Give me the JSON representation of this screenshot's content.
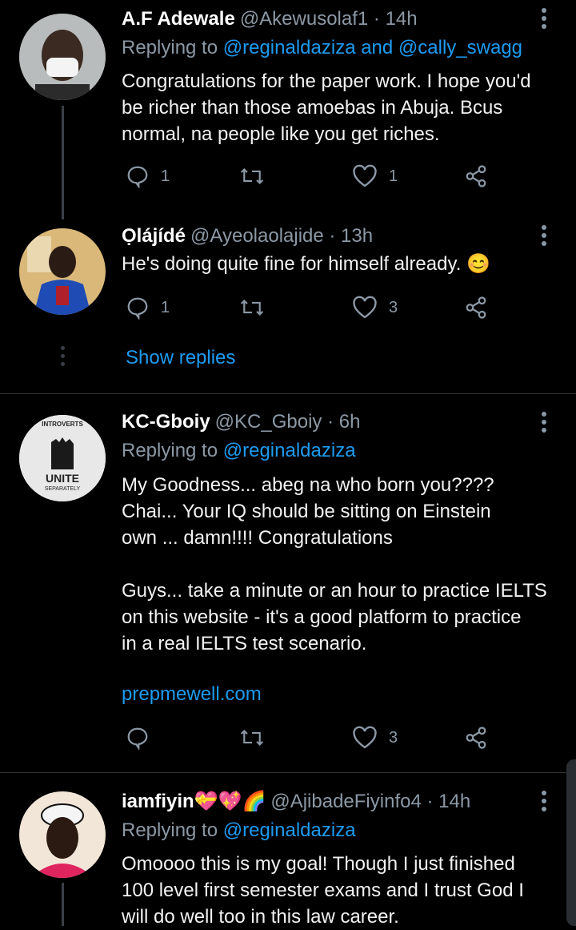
{
  "tweets": [
    {
      "name": "A.F Adewale",
      "handle": "@Akewusolaf1 · 14h",
      "replying_prefix": "Replying to",
      "replying_to": "@reginaldaziza and @cally_swagg",
      "body": "Congratulations for the paper work. I hope you'd\nbe richer than those amoebas in Abuja. Bcus\nnormal, na people like you get riches.",
      "reply_count": "1",
      "like_count": "1"
    },
    {
      "name": "Ọlájídé",
      "handle": "@Ayeolaolajide · 13h",
      "body": "He's doing quite fine for himself already. 😊",
      "reply_count": "1",
      "like_count": "3",
      "show_replies": "Show replies"
    },
    {
      "name": "KC-Gboiy",
      "handle": "@KC_Gboiy · 6h",
      "replying_prefix": "Replying to",
      "replying_to": "@reginaldaziza",
      "body": "My Goodness... abeg na who born you????\nChai... Your IQ should be sitting on Einstein\nown ... damn!!!! Congratulations\n\nGuys... take a minute or an hour to practice IELTS\non this website - it's a good platform to practice\nin a real IELTS test scenario.",
      "link": "prepmewell.com",
      "like_count": "3",
      "avatar_text_top": "INTROVERTS",
      "avatar_text_mid": "UNITE",
      "avatar_text_bot": "SEPARATELY"
    },
    {
      "name": "iamfiyin💝💖🌈",
      "handle": "@AjibadeFiyinfo4 · 14h",
      "replying_prefix": "Replying to",
      "replying_to": "@reginaldaziza",
      "body": "Omoooo this is my goal! Though I just finished\n100 level first semester exams and I trust God I\nwill do well too in this law career."
    }
  ],
  "colors": {
    "link": "#1d9bf0",
    "muted": "#8b98a5",
    "background": "#000000"
  }
}
